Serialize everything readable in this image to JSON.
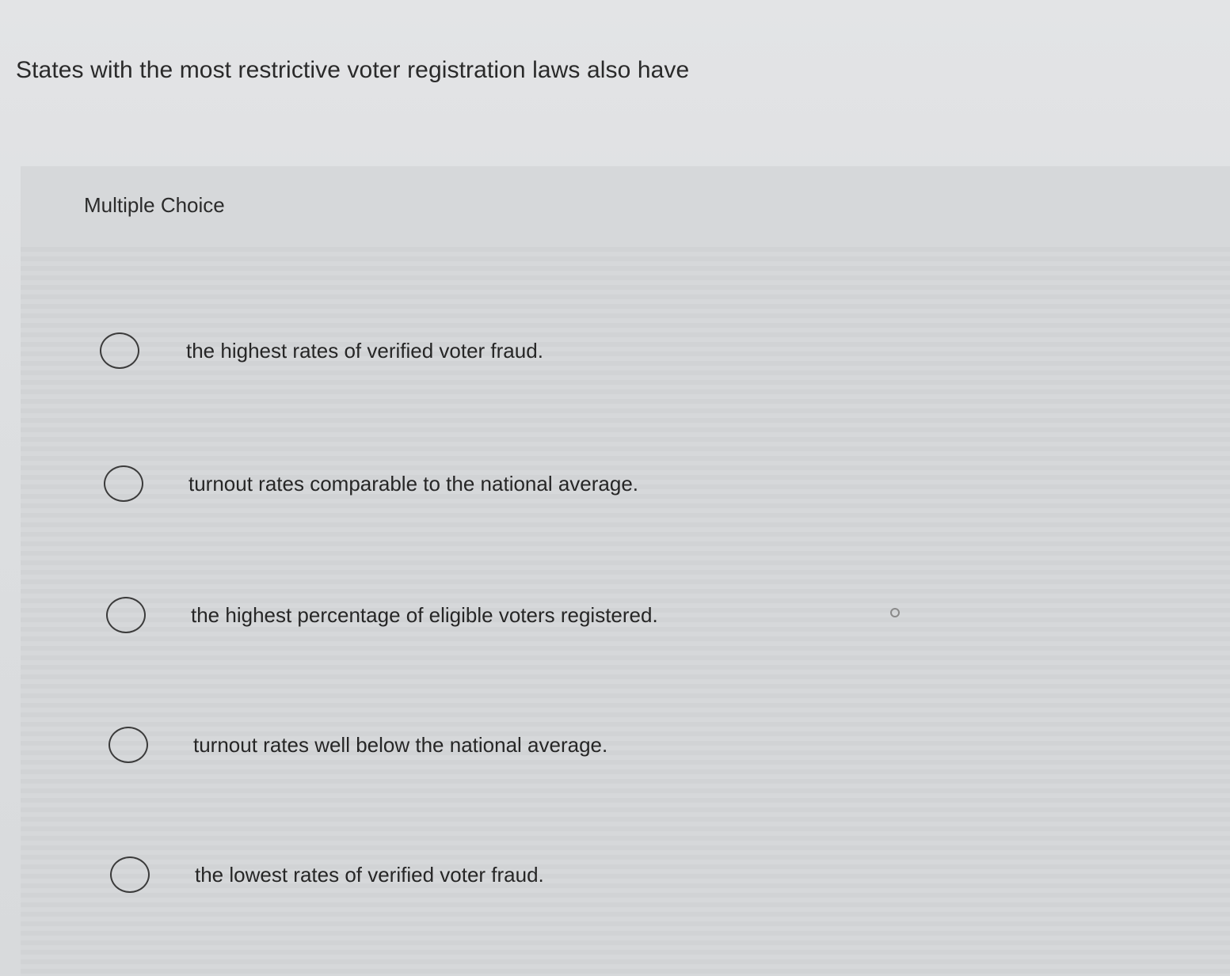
{
  "question": {
    "text": "States with the most restrictive voter registration laws also have"
  },
  "panel": {
    "label": "Multiple Choice"
  },
  "options": [
    {
      "text": "the highest rates of verified voter fraud."
    },
    {
      "text": "turnout rates comparable to the national average."
    },
    {
      "text": "the highest percentage of eligible voters registered."
    },
    {
      "text": "turnout rates well below the national average."
    },
    {
      "text": "the lowest rates of verified voter fraud."
    }
  ],
  "icons": {
    "radio": "radio-unselected-icon"
  },
  "colors": {
    "background": "#dddfe1",
    "panel": "#d3d5d7",
    "text": "#2b2b2b"
  }
}
